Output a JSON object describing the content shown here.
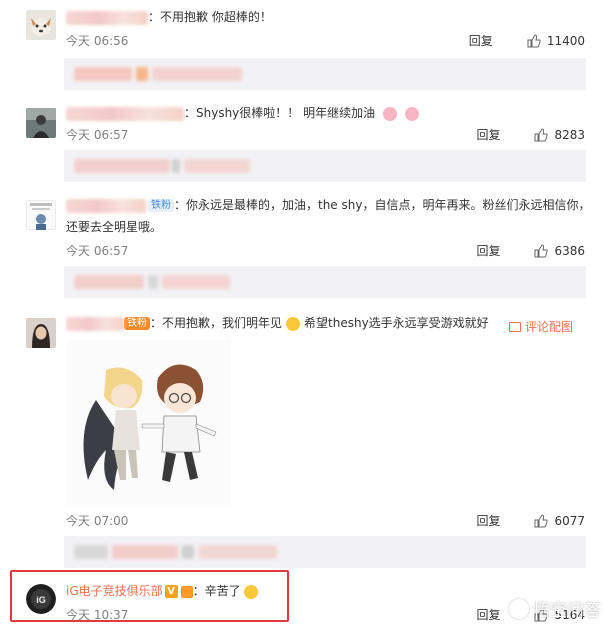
{
  "comments": [
    {
      "text": "：不用抱歉 你超棒的！",
      "time": "今天 06:56",
      "reply": "回复",
      "likes": "11400"
    },
    {
      "text": "：Shyshy很棒啦！！ 明年继续加油",
      "time": "今天 06:57",
      "reply": "回复",
      "likes": "8283"
    },
    {
      "badge": "铁粉",
      "text": "：你永远是最棒的，加油，the shy，自信点，明年再来。粉丝们永远相信你，还要去全明星哦。",
      "time": "今天 06:57",
      "reply": "回复",
      "likes": "6386"
    },
    {
      "badge": "铁粉",
      "text_a": "：不用抱歉，我们明年见",
      "text_b": "希望theshy选手永远享受游戏就好",
      "pic_link": "评论配图",
      "time": "今天 07:00",
      "reply": "回复",
      "likes": "6077"
    },
    {
      "name": "iG电子竞技俱乐部",
      "text": "：辛苦了",
      "time": "今天 10:37",
      "reply": "回复",
      "likes": "5164"
    }
  ],
  "watermark": "悟空问答",
  "colors": {
    "accent": "#eb7350",
    "highlight_border": "#e03a3a",
    "sub_bar": "#f2f2f5",
    "time": "#808080"
  },
  "icons": [
    "thumbs-up-icon",
    "picture-icon",
    "v-badge-icon",
    "flag-emoji-icon",
    "pig-emoji-icon"
  ]
}
